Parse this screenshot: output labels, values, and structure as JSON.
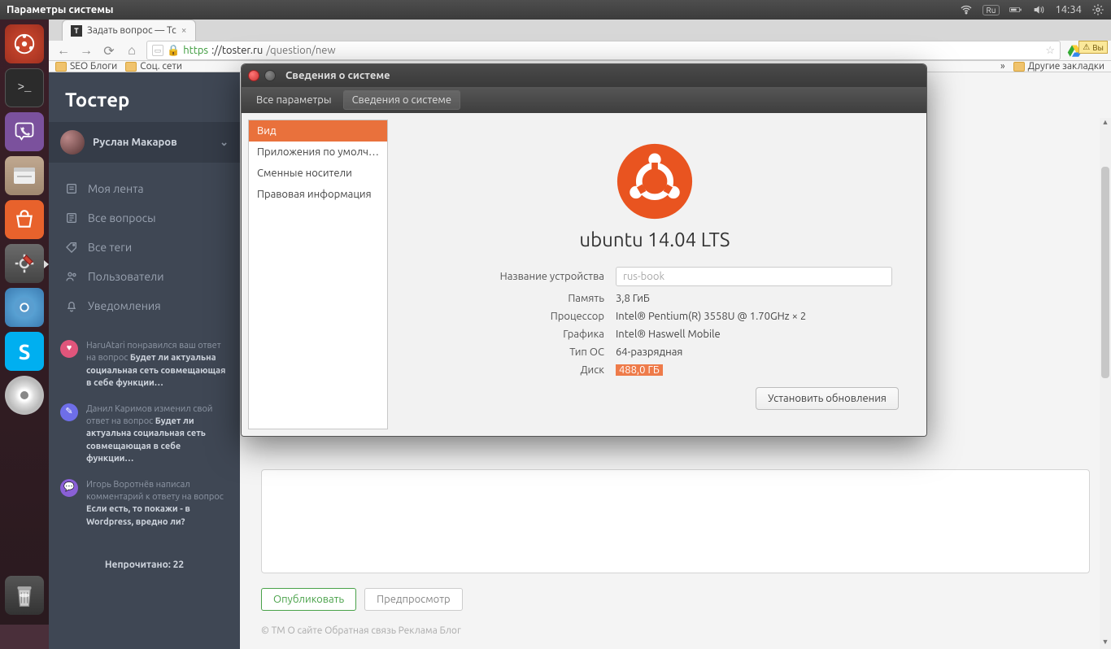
{
  "menubar": {
    "title": "Параметры системы",
    "lang_indicator": "Ru",
    "time": "14:34"
  },
  "browser": {
    "tab_title": "Задать вопрос — Тс",
    "url_prefix": "https",
    "url_host": "://toster.ru",
    "url_path": "/question/new",
    "bookmarks": [
      "SEO Блоги",
      "Соц. сети"
    ],
    "other_bookmarks": "Другие закладки",
    "more_indicator": "»",
    "notice": "Вы"
  },
  "toster": {
    "brand": "Тостер",
    "user": "Руслан Макаров",
    "nav": [
      {
        "label": "Моя лента"
      },
      {
        "label": "Все вопросы"
      },
      {
        "label": "Все теги"
      },
      {
        "label": "Пользователи"
      },
      {
        "label": "Уведомления"
      }
    ],
    "feed": [
      {
        "badge_color": "#e0557b",
        "text_plain": "HaruAtari понравился ваш ответ на вопрос ",
        "text_bold": "Будет ли актуальна социальная сеть совмещающая в себе функции…"
      },
      {
        "badge_color": "#6e6ee8",
        "text_plain": "Данил Каримов изменил свой ответ на вопрос ",
        "text_bold": "Будет ли актуальна социальная сеть совмещающая в себе функции…"
      },
      {
        "badge_color": "#8a60d6",
        "text_plain": "Игорь Воротнёв написал комментарий к ответу на вопрос ",
        "text_bold": "Если есть, то покажи - в Wordpress, вредно ли?"
      }
    ],
    "unread": "Непрочитано: 22",
    "publish": "Опубликовать",
    "preview": "Предпросмотр",
    "footer": "© TM      О сайте      Обратная связь      Реклама      Блог"
  },
  "dialog": {
    "title": "Сведения о системе",
    "breadcrumb_all": "Все параметры",
    "breadcrumb_current": "Сведения о системе",
    "categories": [
      "Вид",
      "Приложения по умолч…",
      "Сменные носители",
      "Правовая информация"
    ],
    "os_name": "ubuntu 14.04 LTS",
    "labels": {
      "device": "Название устройства",
      "memory": "Память",
      "cpu": "Процессор",
      "gpu": "Графика",
      "os_type": "Тип ОС",
      "disk": "Диск"
    },
    "values": {
      "device": "rus-book",
      "memory": "3,8 ГиБ",
      "cpu": "Intel® Pentium(R) 3558U @ 1.70GHz × 2",
      "gpu": "Intel® Haswell Mobile",
      "os_type": "64-разрядная",
      "disk": "488,0 ГБ"
    },
    "update_button": "Установить обновления"
  }
}
